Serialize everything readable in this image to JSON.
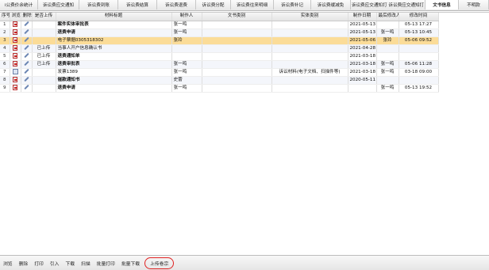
{
  "tabs": [
    {
      "label": "i公费价余统计"
    },
    {
      "label": "诉讼费应交通知"
    },
    {
      "label": "诉讼费到账"
    },
    {
      "label": "诉讼费结算"
    },
    {
      "label": "诉讼费退费"
    },
    {
      "label": "诉讼费分配"
    },
    {
      "label": "诉讼费往来明细"
    },
    {
      "label": "诉讼费补记"
    },
    {
      "label": "诉讼费缓减免"
    },
    {
      "label": "诉讼费应交通知打 诉讼费应交通知打"
    },
    {
      "label": "文书信息"
    },
    {
      "label": "不明款"
    }
  ],
  "table": {
    "headers": [
      "序号",
      "浏览",
      "删除",
      "是否上传",
      "材料标题",
      "制作人",
      "文书类别",
      "实体类别",
      "制作日期",
      "最后修改人",
      "修改时间"
    ],
    "rows": [
      {
        "num": "1",
        "icon": "pdf",
        "uploaded": "",
        "title": "案件实体审批表",
        "maker": "张一鸣",
        "doc_type": "",
        "entity_type": "",
        "date": "2021-05-13",
        "modifier": "",
        "mtime": "05-13 17:27"
      },
      {
        "num": "2",
        "icon": "pdf",
        "uploaded": "",
        "title": "退费申请",
        "maker": "张一鸣",
        "doc_type": "",
        "entity_type": "",
        "date": "2021-05-13",
        "modifier": "张一鸣",
        "mtime": "05-13 10:45"
      },
      {
        "num": "3",
        "icon": "pdf",
        "uploaded": "",
        "title": "电子票据0305318302",
        "maker": "张玲",
        "doc_type": "",
        "entity_type": "",
        "date": "2021-05-06",
        "modifier": "张玲",
        "mtime": "05-06 09:52"
      },
      {
        "num": "4",
        "icon": "pdf",
        "uploaded": "已上传",
        "title": "当事人开户信息确认书",
        "maker": "",
        "doc_type": "",
        "entity_type": "",
        "date": "2021-04-28",
        "modifier": "",
        "mtime": ""
      },
      {
        "num": "5",
        "icon": "pdf",
        "uploaded": "已上传",
        "title": "退费通知单",
        "maker": "",
        "doc_type": "",
        "entity_type": "",
        "date": "2021-03-18",
        "modifier": "",
        "mtime": ""
      },
      {
        "num": "6",
        "icon": "pdf",
        "uploaded": "已上传",
        "title": "退费审批表",
        "maker": "张一鸣",
        "doc_type": "",
        "entity_type": "",
        "date": "2021-03-18",
        "modifier": "张一鸣",
        "mtime": "05-06 11:28"
      },
      {
        "num": "7",
        "icon": "img",
        "uploaded": "",
        "title": "发票1389",
        "maker": "张一鸣",
        "doc_type": "",
        "entity_type": "诉讼材料(电子文档、扫描件等)",
        "date": "2021-03-18",
        "modifier": "张一鸣",
        "mtime": "03-18 09:00"
      },
      {
        "num": "8",
        "icon": "pdf",
        "uploaded": "",
        "title": "催款通知书",
        "maker": "史蕾",
        "doc_type": "",
        "entity_type": "",
        "date": "2020-05-11",
        "modifier": "",
        "mtime": ""
      },
      {
        "num": "9",
        "icon": "pdf",
        "uploaded": "",
        "title": "退费申请",
        "maker": "张一鸣",
        "doc_type": "",
        "entity_type": "",
        "date": "",
        "modifier": "张一鸣",
        "mtime": "05-13 19:52"
      }
    ]
  },
  "bottom_buttons": [
    {
      "label": "浏览"
    },
    {
      "label": "删除"
    },
    {
      "label": "打印"
    },
    {
      "label": "引入"
    },
    {
      "label": "下载"
    },
    {
      "label": "扫描"
    },
    {
      "label": "批量打印"
    },
    {
      "label": "批量下载"
    },
    {
      "label": "上传卷宗"
    }
  ],
  "colors": {
    "selected_row": "#fbdc98",
    "highlight_circle": "#e02020"
  }
}
